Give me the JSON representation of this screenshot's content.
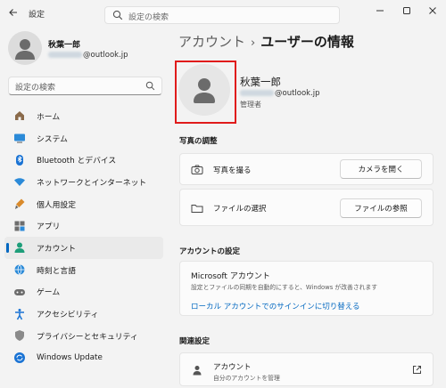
{
  "window": {
    "back_icon": "back-arrow-icon",
    "title": "設定",
    "search_placeholder": "設定の検索",
    "controls": [
      "minimize-icon",
      "maximize-icon",
      "close-icon"
    ]
  },
  "profile": {
    "name": "秋葉一郎",
    "email_domain": "@outlook.jp"
  },
  "sidebar": {
    "search_placeholder": "設定の検索",
    "items": [
      {
        "label": "ホーム",
        "icon": "home-icon"
      },
      {
        "label": "システム",
        "icon": "system-icon"
      },
      {
        "label": "Bluetooth とデバイス",
        "icon": "bluetooth-icon"
      },
      {
        "label": "ネットワークとインターネット",
        "icon": "wifi-icon"
      },
      {
        "label": "個人用設定",
        "icon": "brush-icon"
      },
      {
        "label": "アプリ",
        "icon": "apps-icon"
      },
      {
        "label": "アカウント",
        "icon": "account-icon",
        "active": true
      },
      {
        "label": "時刻と言語",
        "icon": "globe-icon"
      },
      {
        "label": "ゲーム",
        "icon": "gamepad-icon"
      },
      {
        "label": "アクセシビリティ",
        "icon": "accessibility-icon"
      },
      {
        "label": "プライバシーとセキュリティ",
        "icon": "shield-icon"
      },
      {
        "label": "Windows Update",
        "icon": "update-icon"
      }
    ]
  },
  "breadcrumb": {
    "parent": "アカウント",
    "separator": "›",
    "current": "ユーザーの情報"
  },
  "user": {
    "name": "秋葉一郎",
    "email_domain": "@outlook.jp",
    "role": "管理者"
  },
  "photo_section": {
    "title": "写真の調整",
    "rows": [
      {
        "label": "写真を撮る",
        "button": "カメラを開く",
        "icon": "camera-icon"
      },
      {
        "label": "ファイルの選択",
        "button": "ファイルの参照",
        "icon": "folder-icon"
      }
    ]
  },
  "account_settings": {
    "title": "アカウントの設定",
    "ms_title": "Microsoft アカウント",
    "ms_desc": "設定とファイルの同期を自動的にすると、Windows が改善されます",
    "ms_link": "ローカル アカウントでのサインインに切り替える"
  },
  "related": {
    "title": "関連設定",
    "item_title": "アカウント",
    "item_desc": "自分のアカウントを管理",
    "icon": "person-icon",
    "ext_icon": "external-link-icon"
  },
  "colors": {
    "accent": "#0067c0",
    "highlight": "#e01b1b",
    "background": "#f3f3f3"
  }
}
